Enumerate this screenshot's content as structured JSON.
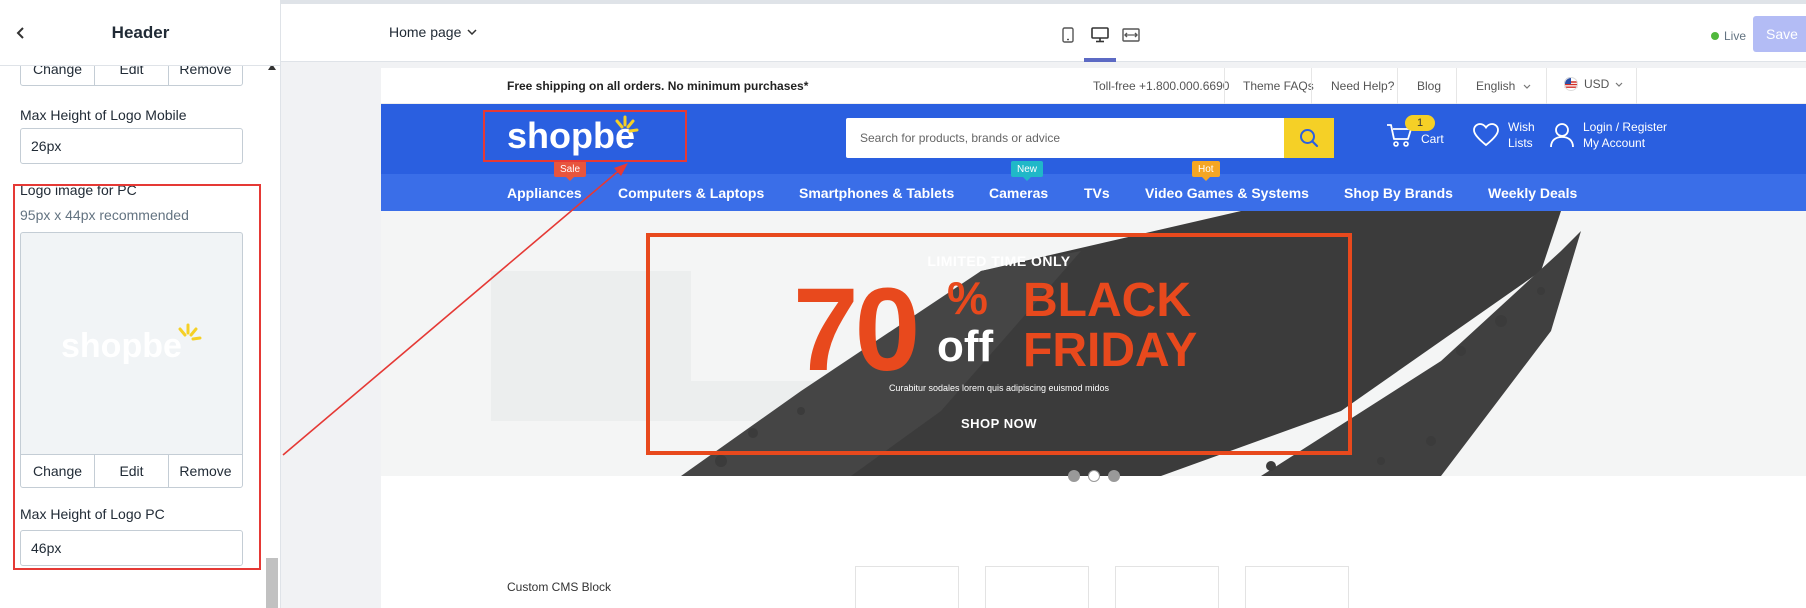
{
  "sidebar": {
    "title": "Header",
    "mobile_buttons": {
      "change": "Change",
      "edit": "Edit",
      "remove": "Remove"
    },
    "mobile_max_height_label": "Max Height of Logo Mobile",
    "mobile_max_height_value": "26px",
    "pc_logo_label": "Logo image for PC",
    "pc_logo_help": "95px x 44px recommended",
    "pc_logo_preview_text": "shopbe",
    "pc_buttons": {
      "change": "Change",
      "edit": "Edit",
      "remove": "Remove"
    },
    "pc_max_height_label": "Max Height of Logo PC",
    "pc_max_height_value": "46px"
  },
  "toolbar": {
    "page_selector": "Home page",
    "devices": [
      "mobile-icon",
      "desktop-icon",
      "fullscreen-icon"
    ],
    "active_device": "desktop",
    "live_label": "Live",
    "save_label": "Save"
  },
  "site": {
    "topstrip": {
      "free_shipping": "Free shipping on all orders. No minimum purchases*",
      "tollfree": "Toll-free +1.800.000.6690",
      "theme_faqs": "Theme FAQs",
      "need_help": "Need Help?",
      "blog": "Blog",
      "language": "English",
      "currency": "USD"
    },
    "logo_text": "shopbe",
    "search_placeholder": "Search for products, brands or advice",
    "cart": {
      "count": "1",
      "label": "Cart"
    },
    "wishlist": {
      "line1": "Wish",
      "line2": "Lists"
    },
    "account": {
      "line1": "Login / Register",
      "line2": "My Account"
    },
    "nav": [
      {
        "label": "Appliances",
        "tag": "Sale"
      },
      {
        "label": "Computers & Laptops",
        "tag": ""
      },
      {
        "label": "Smartphones & Tablets",
        "tag": ""
      },
      {
        "label": "Cameras",
        "tag": "New"
      },
      {
        "label": "TVs",
        "tag": ""
      },
      {
        "label": "Video Games & Systems",
        "tag": "Hot"
      },
      {
        "label": "Shop By Brands",
        "tag": ""
      },
      {
        "label": "Weekly Deals",
        "tag": ""
      }
    ],
    "banner": {
      "limited": "LIMITED TIME ONLY",
      "percent": "70",
      "percent_sign": "%",
      "off": "off",
      "black": "BLACK",
      "friday": "FRIDAY",
      "sub": "Curabitur sodales lorem quis adipiscing euismod midos",
      "shop_now": "SHOP NOW"
    },
    "slider_dots": 3,
    "active_dot": 1,
    "cms_label": "Custom CMS Block"
  },
  "colors": {
    "header_blue": "#2a5fe0",
    "nav_blue": "#3a6ee8",
    "accent_yellow": "#f5d026",
    "promo_orange": "#e8491d",
    "highlight_red": "#e53935",
    "tag_sale": "#e8553e",
    "tag_new": "#20b8c8",
    "tag_hot": "#f5a623"
  }
}
